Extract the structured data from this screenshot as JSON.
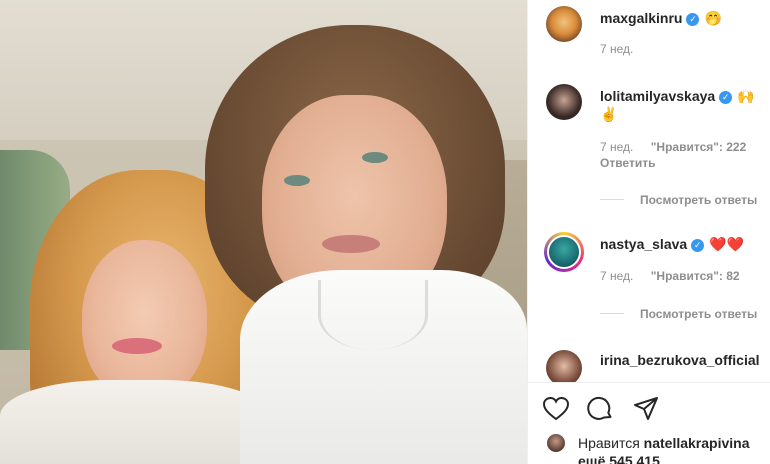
{
  "post": {
    "photo_alt": "selfie-in-car"
  },
  "comments": [
    {
      "username": "maxgalkinru",
      "verified": true,
      "text": "🤭",
      "time": "7 нед.",
      "likes_label": "",
      "reply_label": "",
      "avatar": "cartoon-avatar"
    },
    {
      "username": "lolitamilyavskaya",
      "verified": true,
      "text": "🙌",
      "text_line2": "✌️",
      "time": "7 нед.",
      "likes_label": "\"Нравится\": 222",
      "reply_label": "Ответить",
      "view_replies": "Посмотреть ответы",
      "avatar": "woman-dark-hair-avatar"
    },
    {
      "username": "nastya_slava",
      "verified": true,
      "text": "❤️❤️",
      "time": "7 нед.",
      "likes_label": "\"Нравится\": 82",
      "view_replies": "Посмотреть ответы",
      "avatar": "story-ring-avatar"
    },
    {
      "username": "irina_bezrukova_official",
      "verified": false,
      "avatar": "woman-portrait-avatar"
    }
  ],
  "actions": {
    "like_icon": "heart-icon",
    "comment_icon": "comment-bubble-icon",
    "share_icon": "paper-plane-icon"
  },
  "likes": {
    "prefix": "Нравится",
    "user": "natellakrapivina",
    "more": "ещё 545 415"
  },
  "colors": {
    "verified": "#3897f0",
    "meta": "#8e8e8e",
    "text": "#262626"
  }
}
